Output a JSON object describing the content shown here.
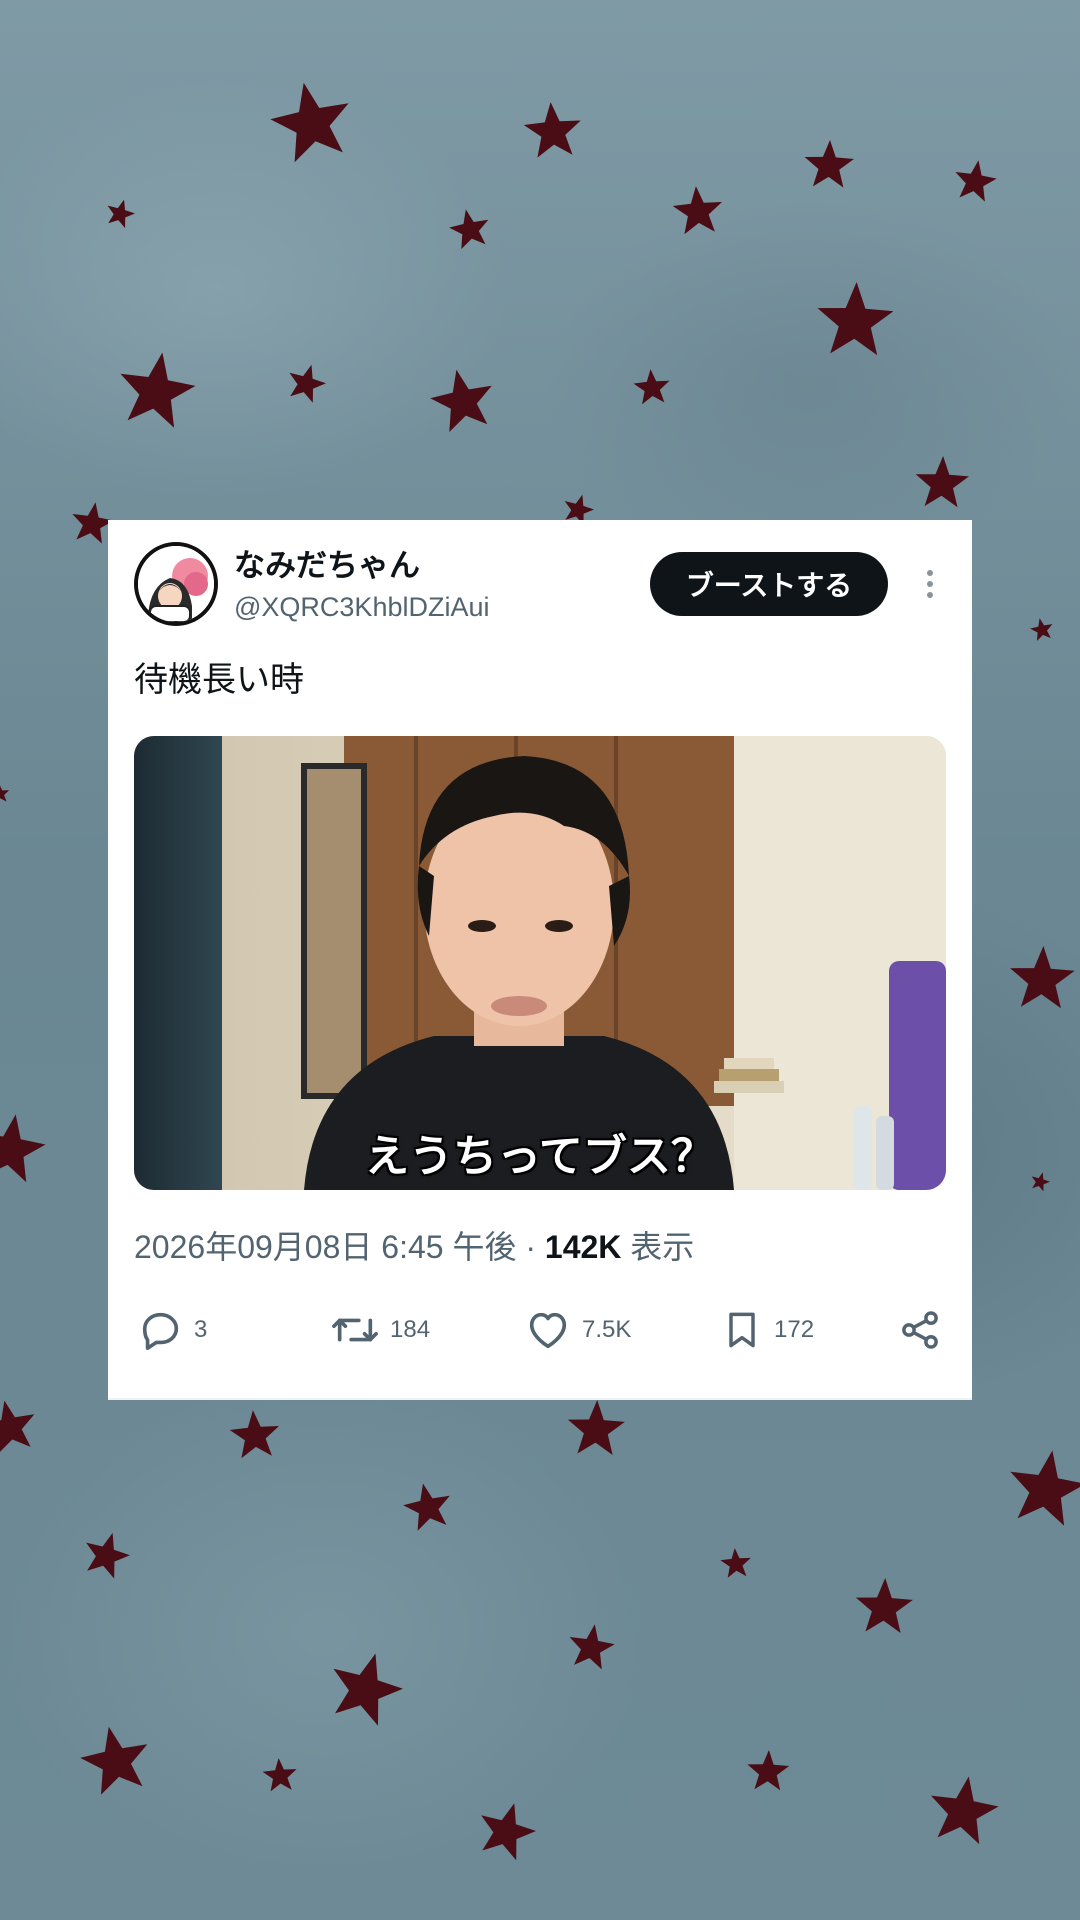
{
  "post": {
    "display_name": "なみだちゃん",
    "handle": "@XQRC3KhblDZiAui",
    "boost_label": "ブーストする",
    "text": "待機長い時",
    "media_caption": "えうちってブス？",
    "timestamp": "2026年09月08日 6:45 午後",
    "separator": "·",
    "views_count": "142K",
    "views_label": "表示"
  },
  "actions": {
    "reply_count": "3",
    "repost_count": "184",
    "like_count": "7.5K",
    "bookmark_count": "172"
  },
  "icons": [
    "reply-icon",
    "repost-icon",
    "like-icon",
    "bookmark-icon",
    "share-icon",
    "more-icon"
  ],
  "colors": {
    "background": "#6f8c97",
    "star": "#4a0d15",
    "button": "#0f1419",
    "secondary_text": "#536471"
  }
}
